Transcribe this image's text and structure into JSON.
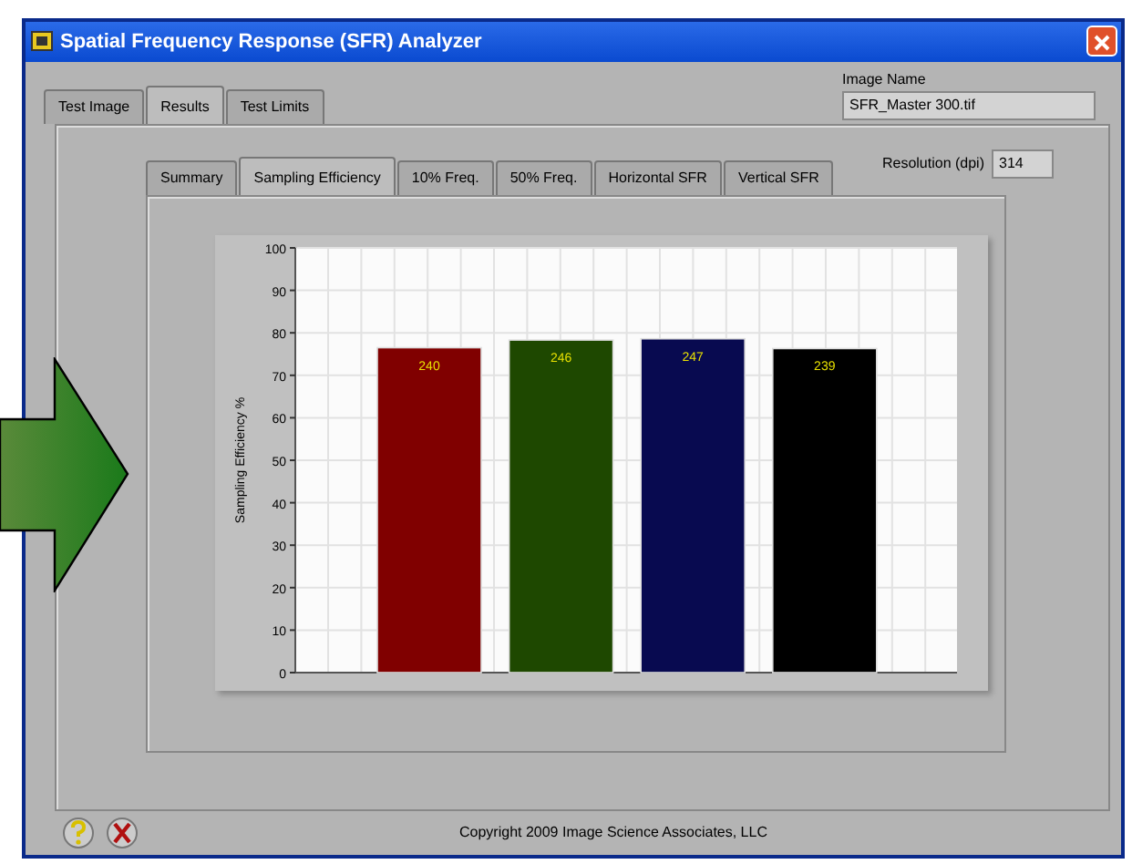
{
  "window": {
    "title": "Spatial Frequency Response (SFR) Analyzer"
  },
  "image_name": {
    "label": "Image Name",
    "value": "SFR_Master 300.tif"
  },
  "tabs": [
    {
      "label": "Test Image",
      "selected": false
    },
    {
      "label": "Results",
      "selected": true
    },
    {
      "label": "Test Limits",
      "selected": false
    }
  ],
  "resolution": {
    "label": "Resolution (dpi)",
    "value": "314"
  },
  "sub_tabs": [
    {
      "label": "Summary",
      "selected": false
    },
    {
      "label": "Sampling Efficiency",
      "selected": true
    },
    {
      "label": "10% Freq.",
      "selected": false
    },
    {
      "label": "50% Freq.",
      "selected": false
    },
    {
      "label": "Horizontal SFR",
      "selected": false
    },
    {
      "label": "Vertical SFR",
      "selected": false
    }
  ],
  "chart": {
    "chart_data": {
      "type": "bar",
      "ylabel": "Sampling Efficiency %",
      "ylim": [
        0,
        100
      ],
      "yticks": [
        0,
        10,
        20,
        30,
        40,
        50,
        60,
        70,
        80,
        90,
        100
      ],
      "grid": true,
      "series": [
        {
          "color": "#800000",
          "values": [
            76.5,
            null,
            null,
            null
          ]
        },
        {
          "color": "#1e4800",
          "values": [
            null,
            78.3,
            null,
            null
          ]
        },
        {
          "color": "#080a50",
          "values": [
            null,
            null,
            78.6,
            null
          ]
        },
        {
          "color": "#000000",
          "values": [
            null,
            null,
            null,
            76.3
          ]
        }
      ],
      "value_labels": [
        "240",
        "246",
        "247",
        "239"
      ]
    }
  },
  "footer": {
    "copyright": "Copyright 2009 Image Science Associates, LLC"
  }
}
